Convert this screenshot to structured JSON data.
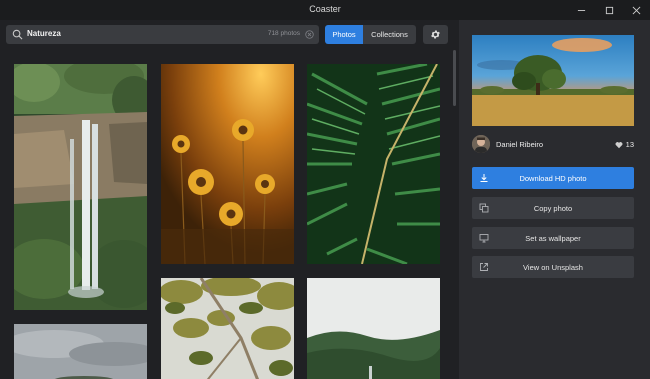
{
  "window": {
    "title": "Coaster"
  },
  "search": {
    "query": "Natureza",
    "results_count": "718 photos"
  },
  "view_tabs": {
    "photos": "Photos",
    "collections": "Collections",
    "active": "Photos"
  },
  "icons": {
    "search": "search-icon",
    "clear": "clear-icon",
    "settings": "gear-icon",
    "download": "download-icon",
    "copy": "copy-icon",
    "wallpaper": "monitor-icon",
    "external": "external-link-icon",
    "heart": "heart-icon"
  },
  "gallery": {
    "photos": [
      {
        "subject": "waterfall"
      },
      {
        "subject": "sunflowers"
      },
      {
        "subject": "fern"
      },
      {
        "subject": "cloudy-sky"
      },
      {
        "subject": "tree-branches"
      },
      {
        "subject": "forest-landscape"
      }
    ]
  },
  "detail": {
    "author": "Daniel Ribeiro",
    "likes": "13",
    "actions": {
      "download": "Download HD photo",
      "copy": "Copy photo",
      "wallpaper": "Set as wallpaper",
      "unsplash": "View on Unsplash"
    }
  },
  "colors": {
    "accent": "#2e7fe0",
    "background": "#202124",
    "panel": "#2a2b2f"
  }
}
